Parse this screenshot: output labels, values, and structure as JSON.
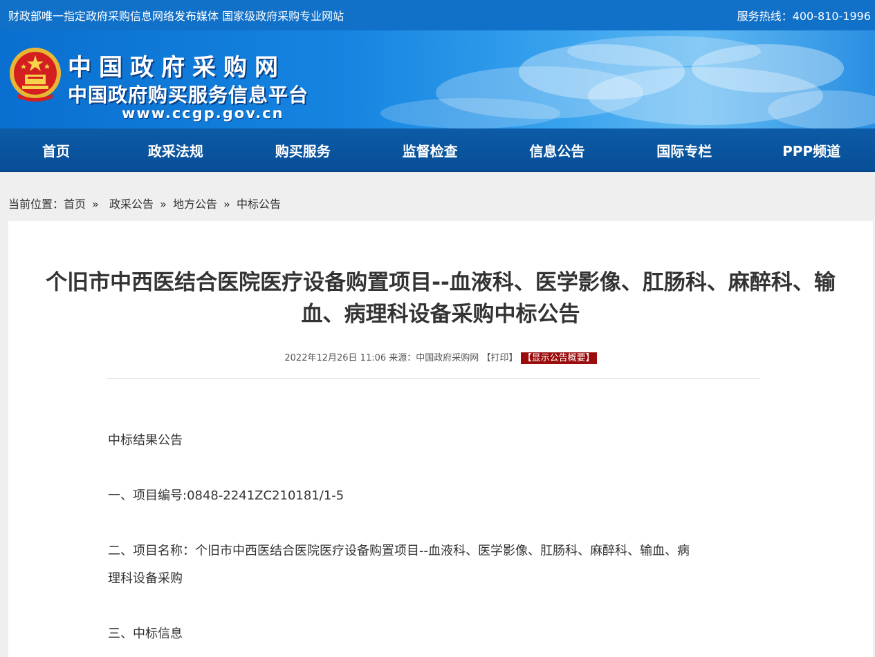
{
  "topbar": {
    "left_text": "财政部唯一指定政府采购信息网络发布媒体 国家级政府采购专业网站",
    "hotline": "服务热线：400-810-1996"
  },
  "banner": {
    "logo_line1": "中国政府采购网",
    "logo_line2": "中国政府购买服务信息平台",
    "logo_url": "www.ccgp.gov.cn"
  },
  "nav": {
    "items": [
      "首页",
      "政采法规",
      "购买服务",
      "监督检查",
      "信息公告",
      "国际专栏",
      "PPP频道"
    ]
  },
  "breadcrumb": {
    "prefix": "当前位置：",
    "items": [
      "首页",
      "政采公告",
      "地方公告",
      "中标公告"
    ],
    "separator": "»"
  },
  "article": {
    "title_line1": "个旧市中西医结合医院医疗设备购置项目--血液科、医学影像、肛肠科、麻醉科、输",
    "title_line2": "血、病理科设备采购中标公告",
    "datetime": "2022年12月26日 11:06",
    "source": "来源：中国政府采购网",
    "print_label": "【打印】",
    "summary_label": "【显示公告概要】",
    "paragraphs": [
      "中标结果公告",
      "一、项目编号:0848-2241ZC210181/1-5",
      "二、项目名称：个旧市中西医结合医院医疗设备购置项目--血液科、医学影像、肛肠科、麻醉科、输血、病",
      "理科设备采购",
      "三、中标信息"
    ]
  }
}
